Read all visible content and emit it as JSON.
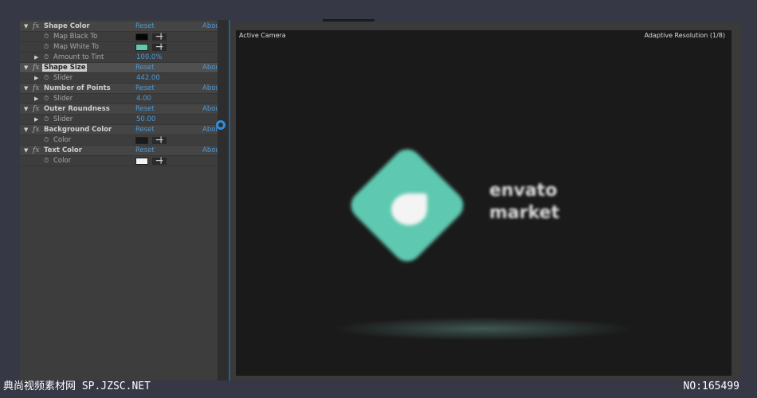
{
  "effects": [
    {
      "name": "Shape Color",
      "reset": "Reset",
      "about": "Abou",
      "params": [
        {
          "name": "Map Black To",
          "type": "color",
          "color": "#050505"
        },
        {
          "name": "Map White To",
          "type": "color",
          "color": "#5ec9b0"
        },
        {
          "name": "Amount to Tint",
          "type": "value",
          "value": "100.0%",
          "expandable": true
        }
      ]
    },
    {
      "name": "Shape Size",
      "reset": "Reset",
      "about": "Abou",
      "selected": true,
      "params": [
        {
          "name": "Slider",
          "type": "value",
          "value": "442.00",
          "expandable": true
        }
      ]
    },
    {
      "name": "Number of Points",
      "reset": "Reset",
      "about": "Abou",
      "params": [
        {
          "name": "Slider",
          "type": "value",
          "value": "4.00",
          "expandable": true
        }
      ]
    },
    {
      "name": "Outer Roundness",
      "reset": "Reset",
      "about": "Abou",
      "params": [
        {
          "name": "Slider",
          "type": "value",
          "value": "50.00",
          "expandable": true
        }
      ]
    },
    {
      "name": "Background Color",
      "reset": "Reset",
      "about": "Abou",
      "params": [
        {
          "name": "Color",
          "type": "color",
          "color": "#1a1a1a"
        }
      ]
    },
    {
      "name": "Text Color",
      "reset": "Reset",
      "about": "Abou",
      "params": [
        {
          "name": "Color",
          "type": "color",
          "color": "#f4f4f4"
        }
      ]
    }
  ],
  "viewer": {
    "camera": "Active Camera",
    "resolution": "Adaptive Resolution (1/8)",
    "wordmark": "envato market"
  },
  "watermark": {
    "left": "典尚视频素材网 SP.JZSC.NET",
    "right": "NO:165499"
  },
  "colors": {
    "accent": "#4d9ad6",
    "logo": "#5ec9b0"
  }
}
